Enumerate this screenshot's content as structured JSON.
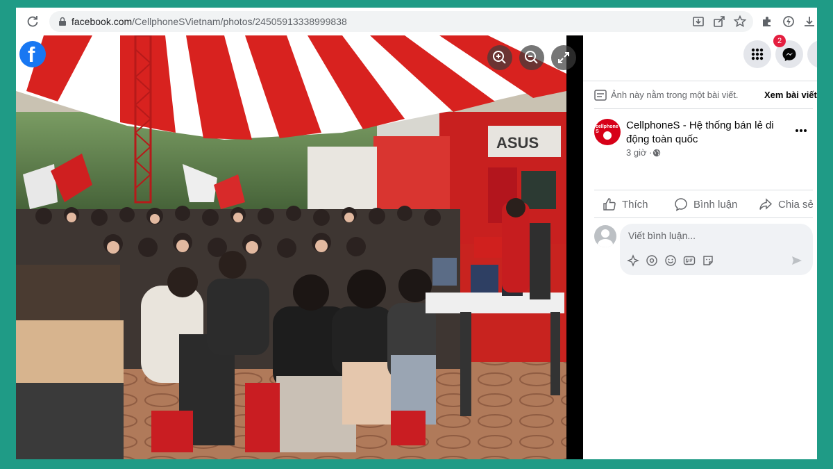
{
  "browser": {
    "url_domain": "facebook.com",
    "url_path": "/CellphoneSVietnam/photos/2450591333899983​8"
  },
  "viewer": {
    "logo_glyph": "f",
    "buttons": [
      "zoom-in-icon",
      "zoom-out-icon",
      "fullscreen-icon"
    ]
  },
  "header": {
    "notification_count": "2"
  },
  "post": {
    "notice_text": "Ảnh này nằm trong một bài viết.",
    "notice_link": "Xem bài viết",
    "avatar_text": "cellphone S",
    "page_name": "CellphoneS - Hệ thống bán lẻ di động toàn quốc",
    "time": "3 giờ ·"
  },
  "actions": {
    "like": "Thích",
    "comment": "Bình luận",
    "share": "Chia sẻ"
  },
  "comment_box": {
    "placeholder": "Viết bình luận..."
  },
  "colors": {
    "background": "#1f9b86",
    "facebook_blue": "#1877f2",
    "brand_red": "#d70018",
    "badge_red": "#e41e3f"
  }
}
